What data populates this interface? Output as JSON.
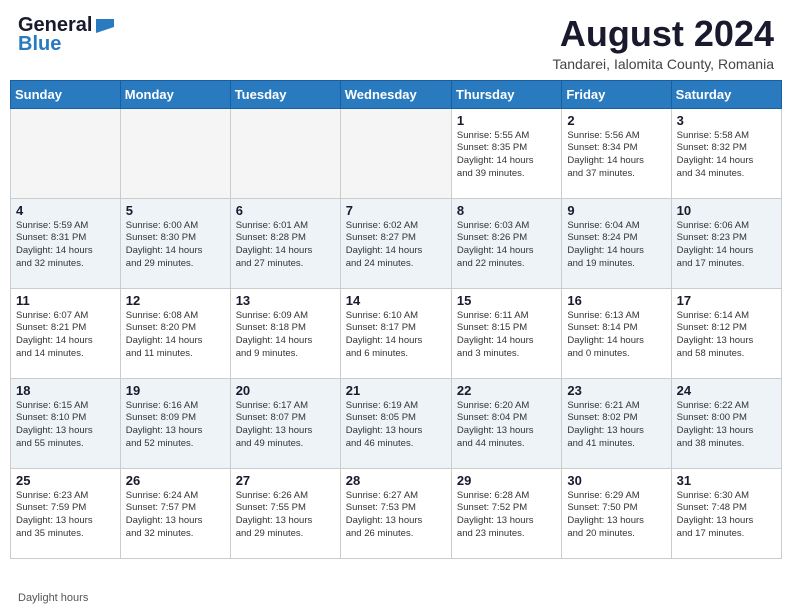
{
  "header": {
    "logo_general": "General",
    "logo_blue": "Blue",
    "month_title": "August 2024",
    "location": "Tandarei, Ialomita County, Romania"
  },
  "days_of_week": [
    "Sunday",
    "Monday",
    "Tuesday",
    "Wednesday",
    "Thursday",
    "Friday",
    "Saturday"
  ],
  "weeks": [
    [
      {
        "num": "",
        "detail": ""
      },
      {
        "num": "",
        "detail": ""
      },
      {
        "num": "",
        "detail": ""
      },
      {
        "num": "",
        "detail": ""
      },
      {
        "num": "1",
        "detail": "Sunrise: 5:55 AM\nSunset: 8:35 PM\nDaylight: 14 hours\nand 39 minutes."
      },
      {
        "num": "2",
        "detail": "Sunrise: 5:56 AM\nSunset: 8:34 PM\nDaylight: 14 hours\nand 37 minutes."
      },
      {
        "num": "3",
        "detail": "Sunrise: 5:58 AM\nSunset: 8:32 PM\nDaylight: 14 hours\nand 34 minutes."
      }
    ],
    [
      {
        "num": "4",
        "detail": "Sunrise: 5:59 AM\nSunset: 8:31 PM\nDaylight: 14 hours\nand 32 minutes."
      },
      {
        "num": "5",
        "detail": "Sunrise: 6:00 AM\nSunset: 8:30 PM\nDaylight: 14 hours\nand 29 minutes."
      },
      {
        "num": "6",
        "detail": "Sunrise: 6:01 AM\nSunset: 8:28 PM\nDaylight: 14 hours\nand 27 minutes."
      },
      {
        "num": "7",
        "detail": "Sunrise: 6:02 AM\nSunset: 8:27 PM\nDaylight: 14 hours\nand 24 minutes."
      },
      {
        "num": "8",
        "detail": "Sunrise: 6:03 AM\nSunset: 8:26 PM\nDaylight: 14 hours\nand 22 minutes."
      },
      {
        "num": "9",
        "detail": "Sunrise: 6:04 AM\nSunset: 8:24 PM\nDaylight: 14 hours\nand 19 minutes."
      },
      {
        "num": "10",
        "detail": "Sunrise: 6:06 AM\nSunset: 8:23 PM\nDaylight: 14 hours\nand 17 minutes."
      }
    ],
    [
      {
        "num": "11",
        "detail": "Sunrise: 6:07 AM\nSunset: 8:21 PM\nDaylight: 14 hours\nand 14 minutes."
      },
      {
        "num": "12",
        "detail": "Sunrise: 6:08 AM\nSunset: 8:20 PM\nDaylight: 14 hours\nand 11 minutes."
      },
      {
        "num": "13",
        "detail": "Sunrise: 6:09 AM\nSunset: 8:18 PM\nDaylight: 14 hours\nand 9 minutes."
      },
      {
        "num": "14",
        "detail": "Sunrise: 6:10 AM\nSunset: 8:17 PM\nDaylight: 14 hours\nand 6 minutes."
      },
      {
        "num": "15",
        "detail": "Sunrise: 6:11 AM\nSunset: 8:15 PM\nDaylight: 14 hours\nand 3 minutes."
      },
      {
        "num": "16",
        "detail": "Sunrise: 6:13 AM\nSunset: 8:14 PM\nDaylight: 14 hours\nand 0 minutes."
      },
      {
        "num": "17",
        "detail": "Sunrise: 6:14 AM\nSunset: 8:12 PM\nDaylight: 13 hours\nand 58 minutes."
      }
    ],
    [
      {
        "num": "18",
        "detail": "Sunrise: 6:15 AM\nSunset: 8:10 PM\nDaylight: 13 hours\nand 55 minutes."
      },
      {
        "num": "19",
        "detail": "Sunrise: 6:16 AM\nSunset: 8:09 PM\nDaylight: 13 hours\nand 52 minutes."
      },
      {
        "num": "20",
        "detail": "Sunrise: 6:17 AM\nSunset: 8:07 PM\nDaylight: 13 hours\nand 49 minutes."
      },
      {
        "num": "21",
        "detail": "Sunrise: 6:19 AM\nSunset: 8:05 PM\nDaylight: 13 hours\nand 46 minutes."
      },
      {
        "num": "22",
        "detail": "Sunrise: 6:20 AM\nSunset: 8:04 PM\nDaylight: 13 hours\nand 44 minutes."
      },
      {
        "num": "23",
        "detail": "Sunrise: 6:21 AM\nSunset: 8:02 PM\nDaylight: 13 hours\nand 41 minutes."
      },
      {
        "num": "24",
        "detail": "Sunrise: 6:22 AM\nSunset: 8:00 PM\nDaylight: 13 hours\nand 38 minutes."
      }
    ],
    [
      {
        "num": "25",
        "detail": "Sunrise: 6:23 AM\nSunset: 7:59 PM\nDaylight: 13 hours\nand 35 minutes."
      },
      {
        "num": "26",
        "detail": "Sunrise: 6:24 AM\nSunset: 7:57 PM\nDaylight: 13 hours\nand 32 minutes."
      },
      {
        "num": "27",
        "detail": "Sunrise: 6:26 AM\nSunset: 7:55 PM\nDaylight: 13 hours\nand 29 minutes."
      },
      {
        "num": "28",
        "detail": "Sunrise: 6:27 AM\nSunset: 7:53 PM\nDaylight: 13 hours\nand 26 minutes."
      },
      {
        "num": "29",
        "detail": "Sunrise: 6:28 AM\nSunset: 7:52 PM\nDaylight: 13 hours\nand 23 minutes."
      },
      {
        "num": "30",
        "detail": "Sunrise: 6:29 AM\nSunset: 7:50 PM\nDaylight: 13 hours\nand 20 minutes."
      },
      {
        "num": "31",
        "detail": "Sunrise: 6:30 AM\nSunset: 7:48 PM\nDaylight: 13 hours\nand 17 minutes."
      }
    ]
  ],
  "footer": {
    "daylight_label": "Daylight hours"
  }
}
